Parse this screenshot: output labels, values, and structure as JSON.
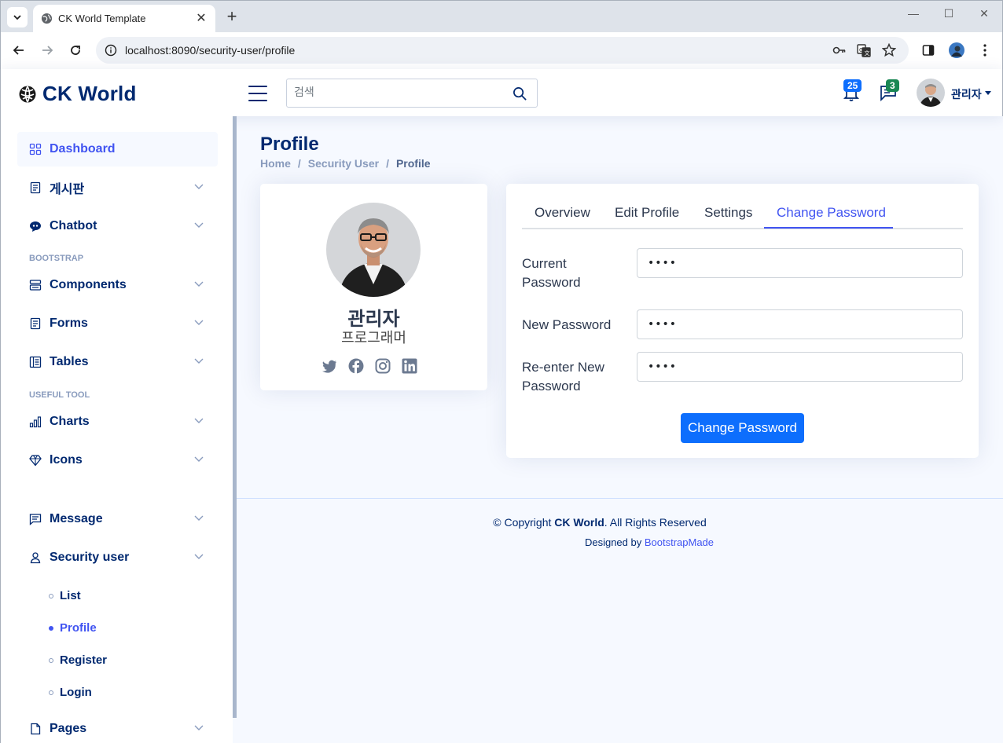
{
  "browser": {
    "tab_title": "CK World Template",
    "url": "localhost:8090/security-user/profile"
  },
  "header": {
    "logo_text": "CK World",
    "search_placeholder": "검색",
    "notifications_count": "25",
    "messages_count": "3",
    "user_name": "관리자"
  },
  "sidebar": {
    "items": [
      {
        "label": "Dashboard"
      },
      {
        "label": "게시판"
      },
      {
        "label": "Chatbot"
      },
      {
        "label": "Components"
      },
      {
        "label": "Forms"
      },
      {
        "label": "Tables"
      },
      {
        "label": "Charts"
      },
      {
        "label": "Icons"
      },
      {
        "label": "Message"
      },
      {
        "label": "Security user"
      },
      {
        "label": "Pages"
      }
    ],
    "headings": [
      "BOOTSTRAP",
      "USEFUL TOOL"
    ],
    "security_sub": [
      {
        "label": "List"
      },
      {
        "label": "Profile"
      },
      {
        "label": "Register"
      },
      {
        "label": "Login"
      }
    ]
  },
  "page": {
    "title": "Profile",
    "breadcrumb": [
      "Home",
      "Security User",
      "Profile"
    ]
  },
  "profile": {
    "name": "관리자",
    "job": "프로그래머"
  },
  "tabs": [
    "Overview",
    "Edit Profile",
    "Settings",
    "Change Password"
  ],
  "form": {
    "current_label": "Current Password",
    "new_label": "New Password",
    "renew_label": "Re-enter New Password",
    "current_value": "••••",
    "new_value": "••••",
    "renew_value": "••••",
    "submit": "Change Password"
  },
  "footer": {
    "copy_prefix": "© Copyright ",
    "brand": "CK World",
    "copy_suffix": ". All Rights Reserved",
    "designed_by": "Designed by ",
    "designer": "BootstrapMade"
  },
  "colors": {
    "accent": "#4154f1",
    "brand": "#012970",
    "primary_button": "#0d6efd",
    "notif_badge": "#0d6efd",
    "msg_badge": "#198754"
  }
}
